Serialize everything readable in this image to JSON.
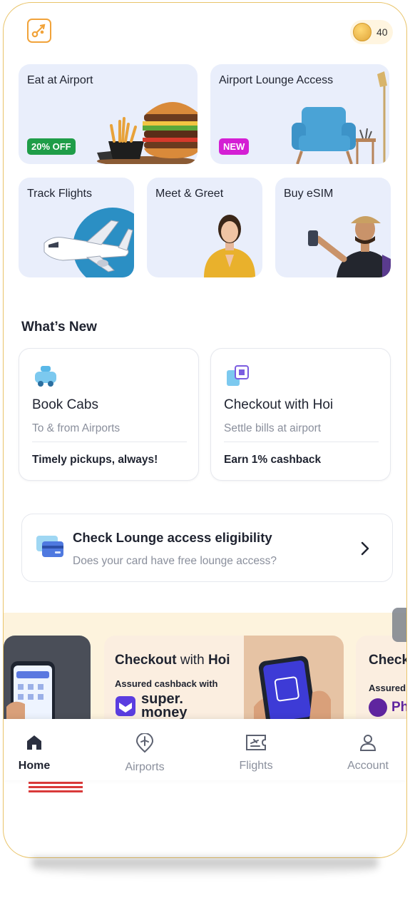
{
  "header": {
    "coin_count": "40"
  },
  "services": {
    "eat": {
      "title": "Eat at Airport",
      "badge": "20% OFF"
    },
    "lounge": {
      "title": "Airport Lounge Access",
      "badge": "NEW"
    },
    "track": {
      "title": "Track Flights"
    },
    "meet": {
      "title": "Meet & Greet"
    },
    "esim": {
      "title": "Buy eSIM"
    }
  },
  "whats_new": {
    "title": "What’s New",
    "cards": [
      {
        "title": "Book Cabs",
        "subtitle": "To & from Airports",
        "footer": "Timely pickups, always!"
      },
      {
        "title": "Checkout with Hoi",
        "subtitle": "Settle bills at airport",
        "footer": "Earn 1% cashback"
      }
    ]
  },
  "lounge_check": {
    "title": "Check Lounge access eligibility",
    "subtitle": "Does your card have free lounge access?"
  },
  "promo": {
    "title_a": "Checkout",
    "title_b": "with",
    "title_c": "Hoi",
    "subtitle": "Assured cashback with",
    "brand_a": "super.",
    "brand_b": "money",
    "partial_title": "Check",
    "partial_sub": "Assured c",
    "partial_brand": "Ph"
  },
  "nav": {
    "items": [
      {
        "label": "Home",
        "icon": "home-icon",
        "active": true
      },
      {
        "label": "Airports",
        "icon": "airport-pin-icon",
        "active": false
      },
      {
        "label": "Flights",
        "icon": "boarding-pass-icon",
        "active": false
      },
      {
        "label": "Account",
        "icon": "user-icon",
        "active": false
      }
    ]
  },
  "colors": {
    "accent_orange": "#f1a33a",
    "tile_bg": "#e9eefb",
    "badge_green": "#1f9d48",
    "badge_magenta": "#d41fd4",
    "text_dark": "#1f2330",
    "text_muted": "#8a8f9c",
    "promo_bg": "#fdf3dd"
  }
}
